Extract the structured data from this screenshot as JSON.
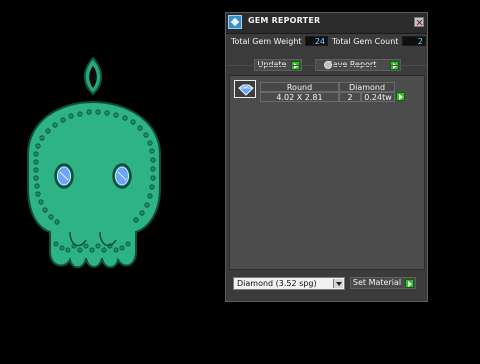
{
  "viewport": {
    "model": "skull-pendant"
  },
  "panel": {
    "title": "GEM REPORTER",
    "total_weight_label": "Total Gem Weight",
    "total_weight_value": "24",
    "total_count_label": "Total Gem Count",
    "total_count_value": "2",
    "update_label": "Update",
    "save_report_label": "Save Report",
    "table": {
      "header": {
        "shape": "Round",
        "material": "Diamond"
      },
      "rows": [
        {
          "size": "4.02 X 2.81",
          "count": "2",
          "weight": "0.24tw"
        }
      ]
    },
    "material_select": {
      "value": "Diamond    (3.52 spg)"
    },
    "set_material_label": "Set Material"
  },
  "colors": {
    "accent_green": "#2fbf2f",
    "value_blue": "#86d2ff",
    "model_green": "#2db386",
    "gem_blue": "#6aa6ff"
  },
  "icons": [
    "gem-reporter-app-icon",
    "close-icon",
    "go-arrow-icon",
    "gem-thumbnail-icon",
    "dropdown-arrow-icon"
  ]
}
